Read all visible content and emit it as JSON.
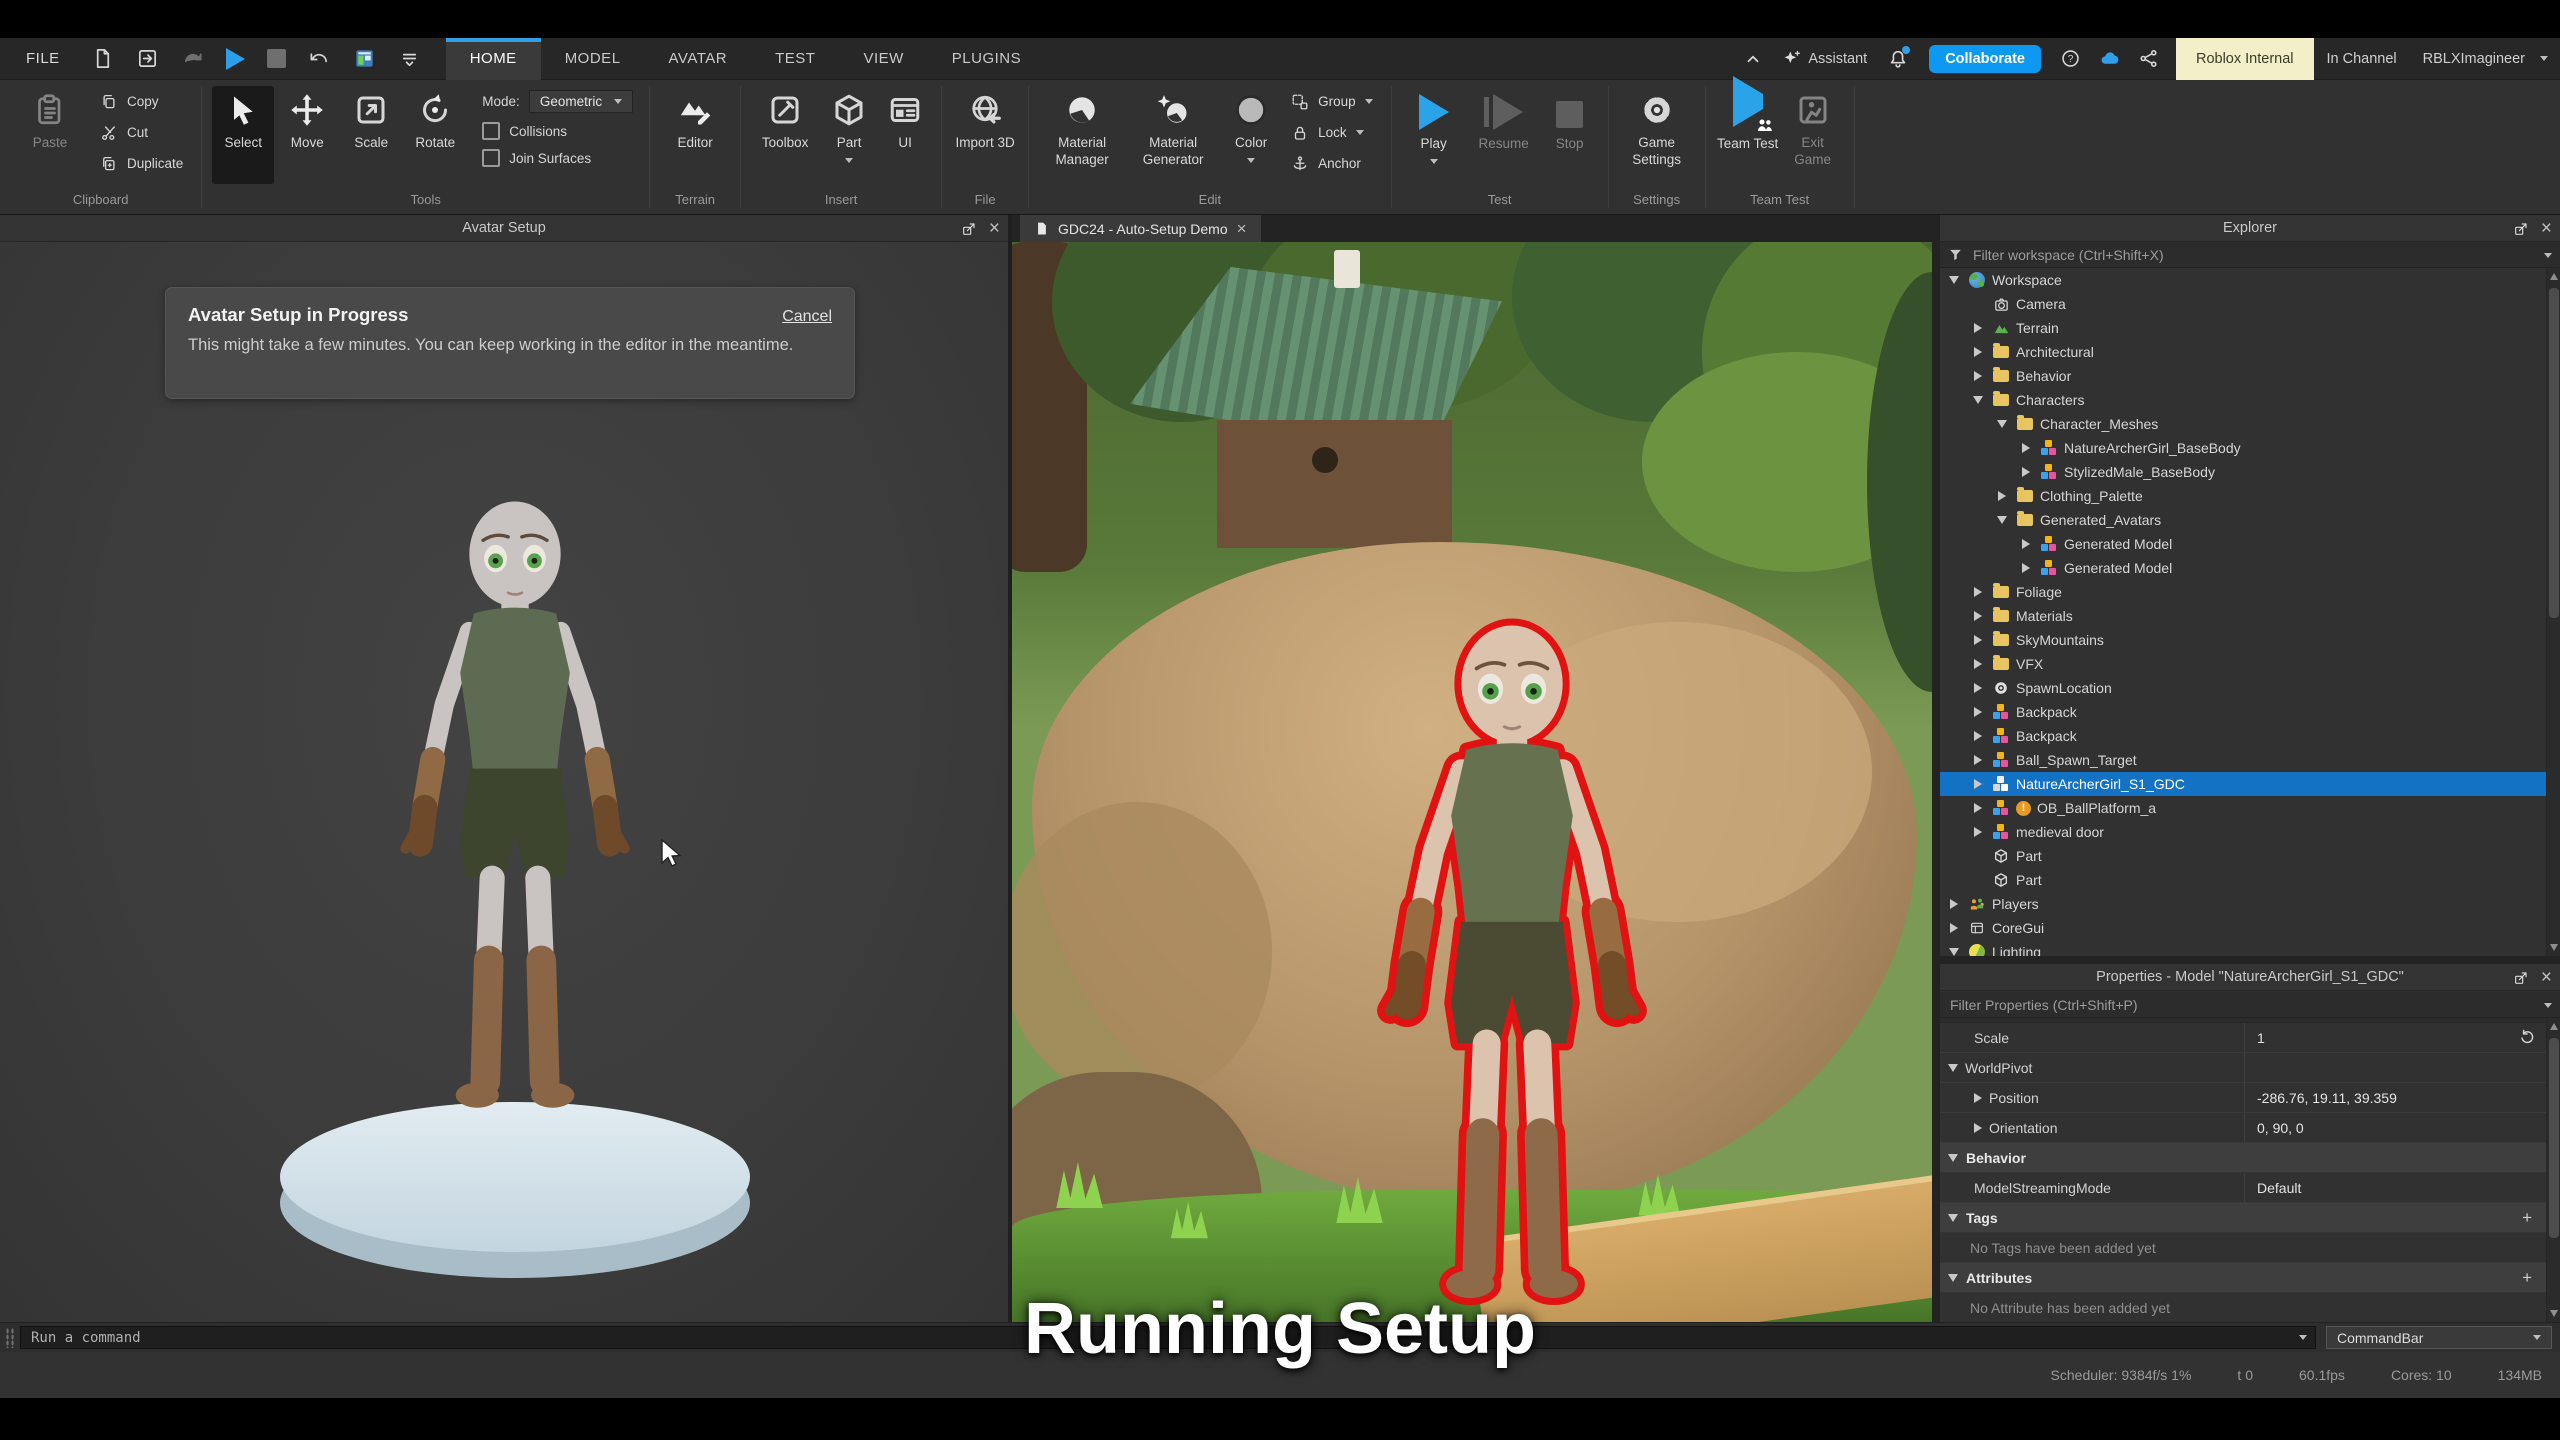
{
  "menubar": {
    "file": "FILE",
    "tabs": [
      {
        "label": "HOME",
        "active": true
      },
      {
        "label": "MODEL",
        "active": false
      },
      {
        "label": "AVATAR",
        "active": false
      },
      {
        "label": "TEST",
        "active": false
      },
      {
        "label": "VIEW",
        "active": false
      },
      {
        "label": "PLUGINS",
        "active": false
      }
    ],
    "assistant": "Assistant",
    "collaborate": "Collaborate",
    "internal_badge": "Roblox Internal",
    "channel": "In Channel",
    "username": "RBLXImagineer"
  },
  "ribbon": {
    "clipboard": {
      "label": "Clipboard",
      "paste": "Paste",
      "copy": "Copy",
      "cut": "Cut",
      "duplicate": "Duplicate"
    },
    "tools": {
      "label": "Tools",
      "select": "Select",
      "move": "Move",
      "scale": "Scale",
      "rotate": "Rotate",
      "mode_label": "Mode:",
      "mode_value": "Geometric",
      "collisions": "Collisions",
      "join_surfaces": "Join Surfaces"
    },
    "terrain": {
      "label": "Terrain",
      "editor": "Editor"
    },
    "insert": {
      "label": "Insert",
      "toolbox": "Toolbox",
      "part": "Part",
      "ui": "UI"
    },
    "file": {
      "label": "File",
      "import_3d": "Import 3D"
    },
    "edit": {
      "label": "Edit",
      "material_manager": "Material Manager",
      "material_generator": "Material Generator",
      "color": "Color",
      "group": "Group",
      "lock": "Lock",
      "anchor": "Anchor"
    },
    "test": {
      "label": "Test",
      "play": "Play",
      "resume": "Resume",
      "stop": "Stop"
    },
    "settings": {
      "label": "Settings",
      "game_settings": "Game Settings"
    },
    "team_test": {
      "label": "Team Test",
      "team_test": "Team Test",
      "exit_game": "Exit Game"
    }
  },
  "avatar_panel": {
    "title": "Avatar Setup",
    "notice_title": "Avatar Setup in Progress",
    "notice_cancel": "Cancel",
    "notice_body": "This might take a few minutes. You can keep working in the editor in the meantime."
  },
  "viewport": {
    "tab_title": "GDC24 - Auto-Setup Demo"
  },
  "explorer": {
    "title": "Explorer",
    "filter": "Filter workspace (Ctrl+Shift+X)",
    "tree": [
      {
        "label": "Workspace",
        "icon": "workspace",
        "level": 0,
        "arrow": "down"
      },
      {
        "label": "Camera",
        "icon": "camera",
        "level": 1,
        "arrow": null
      },
      {
        "label": "Terrain",
        "icon": "terrain",
        "level": 1,
        "arrow": "right"
      },
      {
        "label": "Architectural",
        "icon": "folder",
        "level": 1,
        "arrow": "right"
      },
      {
        "label": "Behavior",
        "icon": "folder",
        "level": 1,
        "arrow": "right"
      },
      {
        "label": "Characters",
        "icon": "folder",
        "level": 1,
        "arrow": "down"
      },
      {
        "label": "Character_Meshes",
        "icon": "folder",
        "level": 2,
        "arrow": "down"
      },
      {
        "label": "NatureArcherGirl_BaseBody",
        "icon": "model",
        "level": 3,
        "arrow": "right"
      },
      {
        "label": "StylizedMale_BaseBody",
        "icon": "model",
        "level": 3,
        "arrow": "right"
      },
      {
        "label": "Clothing_Palette",
        "icon": "folder",
        "level": 2,
        "arrow": "right"
      },
      {
        "label": "Generated_Avatars",
        "icon": "folder",
        "level": 2,
        "arrow": "down"
      },
      {
        "label": "Generated Model",
        "icon": "model",
        "level": 3,
        "arrow": "right"
      },
      {
        "label": "Generated Model",
        "icon": "model",
        "level": 3,
        "arrow": "right"
      },
      {
        "label": "Foliage",
        "icon": "folder",
        "level": 1,
        "arrow": "right"
      },
      {
        "label": "Materials",
        "icon": "folder",
        "level": 1,
        "arrow": "right"
      },
      {
        "label": "SkyMountains",
        "icon": "folder",
        "level": 1,
        "arrow": "right"
      },
      {
        "label": "VFX",
        "icon": "folder",
        "level": 1,
        "arrow": "right"
      },
      {
        "label": "SpawnLocation",
        "icon": "spawn",
        "level": 1,
        "arrow": "right"
      },
      {
        "label": "Backpack",
        "icon": "model",
        "level": 1,
        "arrow": "right"
      },
      {
        "label": "Backpack",
        "icon": "model",
        "level": 1,
        "arrow": "right"
      },
      {
        "label": "Ball_Spawn_Target",
        "icon": "model",
        "level": 1,
        "arrow": "right"
      },
      {
        "label": "NatureArcherGirl_S1_GDC",
        "icon": "model-white",
        "level": 1,
        "arrow": "right",
        "selected": true
      },
      {
        "label": "OB_BallPlatform_a",
        "icon": "model",
        "level": 1,
        "arrow": "right",
        "warning": true
      },
      {
        "label": "medieval door",
        "icon": "model",
        "level": 1,
        "arrow": "right"
      },
      {
        "label": "Part",
        "icon": "part",
        "level": 1,
        "arrow": null
      },
      {
        "label": "Part",
        "icon": "part",
        "level": 1,
        "arrow": null
      },
      {
        "label": "Players",
        "icon": "players",
        "level": 0,
        "arrow": "right"
      },
      {
        "label": "CoreGui",
        "icon": "coregui",
        "level": 0,
        "arrow": "right"
      },
      {
        "label": "Lighting",
        "icon": "lighting",
        "level": 0,
        "arrow": "down"
      }
    ]
  },
  "properties": {
    "title": "Properties - Model \"NatureArcherGirl_S1_GDC\"",
    "filter": "Filter Properties (Ctrl+Shift+P)",
    "rows": [
      {
        "type": "prop",
        "label": "Scale",
        "value": "1",
        "indent": 1,
        "reset": true
      },
      {
        "type": "group",
        "label": "WorldPivot",
        "arrow": "down",
        "indent": 0
      },
      {
        "type": "prop",
        "label": "Position",
        "value": "-286.76, 19.11, 39.359",
        "arrow": "right",
        "indent": 1
      },
      {
        "type": "prop",
        "label": "Orientation",
        "value": "0, 90, 0",
        "arrow": "right",
        "indent": 1
      },
      {
        "type": "section",
        "label": "Behavior",
        "arrow": "down"
      },
      {
        "type": "prop",
        "label": "ModelStreamingMode",
        "value": "Default",
        "indent": 1
      },
      {
        "type": "section",
        "label": "Tags",
        "arrow": "down",
        "plus": true
      },
      {
        "type": "note",
        "label": "No Tags have been added yet"
      },
      {
        "type": "section",
        "label": "Attributes",
        "arrow": "down",
        "plus": true
      },
      {
        "type": "note",
        "label": "No Attribute has been added yet"
      }
    ]
  },
  "command_bar": {
    "placeholder": "Run a command",
    "selector": "CommandBar"
  },
  "status_bar": {
    "scheduler": "Scheduler: 9384f/s 1%",
    "t": "t 0",
    "fps": "60.1fps",
    "cores": "Cores: 10",
    "memory": "134MB"
  },
  "caption": "Running Setup",
  "colors": {
    "accent_blue": "#00a2ff",
    "selection_blue": "#1472c4",
    "internal_badge_bg": "#f3f0c9",
    "caption": "#ffffff"
  }
}
